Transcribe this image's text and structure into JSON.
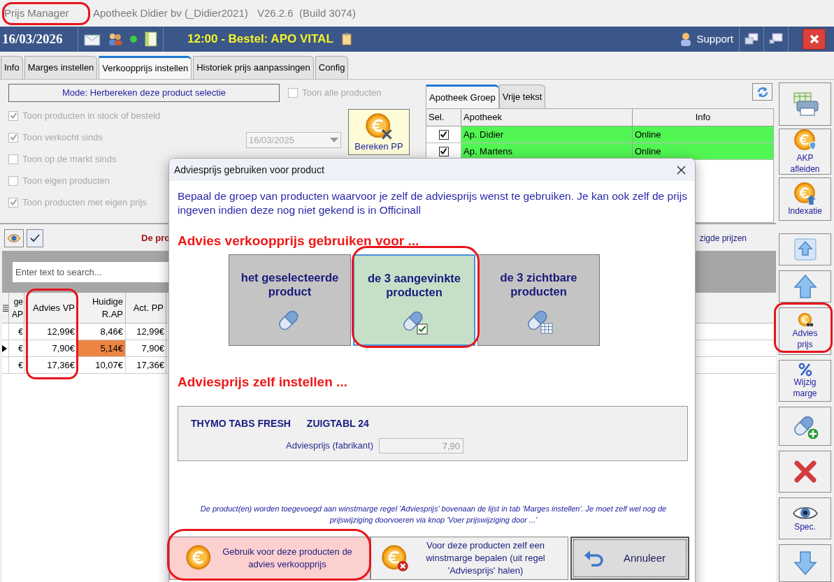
{
  "app": {
    "title": "Prijs Manager",
    "company": "Apotheek Didier bv (_Didier2021)",
    "version": "V26.2.6  (Build 3074)"
  },
  "topbar": {
    "date": "16/03/2026",
    "order": "12:00 - Bestel: APO VITAL",
    "support": "Support"
  },
  "tabs": [
    {
      "label": "Info",
      "selected": false
    },
    {
      "label": "Marges instellen",
      "selected": false
    },
    {
      "label": "Verkoopprijs instellen",
      "selected": true
    },
    {
      "label": "Historiek prijs aanpassingen",
      "selected": false
    },
    {
      "label": "Config",
      "selected": false
    }
  ],
  "mode_button": "Mode: Herbereken deze product selectie",
  "show_all": {
    "label": "Toon alle producten",
    "checked": false
  },
  "filters": [
    {
      "label": "Toon producten in stock of besteld",
      "checked": true
    },
    {
      "label": "Toon verkocht sinds",
      "checked": true,
      "date": "16/03/2025"
    },
    {
      "label": "Toon op de markt sinds",
      "checked": false
    },
    {
      "label": "Toon eigen producten",
      "checked": false
    },
    {
      "label": "Toon producten met eigen prijs",
      "checked": true
    }
  ],
  "calc_button": "Bereken PP",
  "group_tabs": [
    {
      "label": "Apotheek Groep",
      "selected": true
    },
    {
      "label": "Vrije tekst",
      "selected": false
    }
  ],
  "group_table": {
    "columns": [
      "Sel.",
      "Apotheek",
      "Info"
    ],
    "rows": [
      {
        "checked": true,
        "name": "Ap. Didier",
        "info": "Online"
      },
      {
        "checked": true,
        "name": "Ap. Martens",
        "info": "Online"
      }
    ]
  },
  "side_buttons": [
    {
      "kind": "print"
    },
    {
      "kind": "akp",
      "label": "AKP afleiden"
    },
    {
      "kind": "index",
      "label": "Indexatie"
    }
  ],
  "nav_buttons": [
    {
      "kind": "top"
    },
    {
      "kind": "up"
    },
    {
      "kind": "advies",
      "label": "Advies prijs"
    },
    {
      "kind": "marge",
      "label": "Wijzig marge"
    },
    {
      "kind": "add"
    },
    {
      "kind": "delete"
    },
    {
      "kind": "spec",
      "label": "Spec."
    },
    {
      "kind": "down"
    }
  ],
  "list_toolbar": {
    "view_checked": true,
    "message": "De pro",
    "right_text": "zigde prijzen"
  },
  "search": {
    "placeholder": "Enter text to search..."
  },
  "table": {
    "columns": [
      "ge AP",
      "Advies VP",
      "Huidige R.AP",
      "Act. PP"
    ],
    "rows": [
      {
        "selected": false,
        "flagged": false,
        "cells": [
          "€",
          "12,99€",
          "8,46€",
          "12,99€"
        ]
      },
      {
        "selected": true,
        "flagged": true,
        "cells": [
          "€",
          "7,90€",
          "5,14€",
          "7,90€"
        ]
      },
      {
        "selected": false,
        "flagged": false,
        "cells": [
          "€",
          "17,36€",
          "10,07€",
          "17,36€"
        ]
      }
    ]
  },
  "dialog": {
    "title": "Adviesprijs gebruiken voor product",
    "intro": "Bepaal de groep van producten waarvoor je zelf de adviesprijs wenst te gebruiken. Je kan ook zelf de prijs ingeven indien deze nog niet gekend is in Officinall",
    "section1": "Advies verkoopprijs gebruiken voor ...",
    "options": [
      {
        "kind": "single",
        "label": "het geselecteerde product",
        "selected": false
      },
      {
        "kind": "checked",
        "label": "de 3 aangevinkte producten",
        "selected": true
      },
      {
        "kind": "visible",
        "label": "de 3 zichtbare producten",
        "selected": false
      }
    ],
    "section2": "Adviesprijs zelf instellen ...",
    "product": {
      "name": "THYMO TABS FRESH",
      "pack": "ZUIGTABL 24"
    },
    "price_label": "Adviesprijs (fabrikant)",
    "price_value": "7,90",
    "note": "De product(en) worden toegevoegd aan winstmarge regel 'Adviesprijs' bovenaan de lijst in tab 'Marges instellen'. Je moet zelf wel nog de prijswijziging doorvoeren via knop 'Voer prijswijziging door ...'",
    "buttons": [
      {
        "kind": "accept",
        "label": "Gebruik voor deze producten de advies verkoopprijs"
      },
      {
        "kind": "own_margin",
        "label": "Voor deze producten zelf een winstmarge bepalen (uit regel 'Adviesprijs' halen)"
      },
      {
        "kind": "cancel",
        "label": "Annuleer"
      }
    ]
  }
}
